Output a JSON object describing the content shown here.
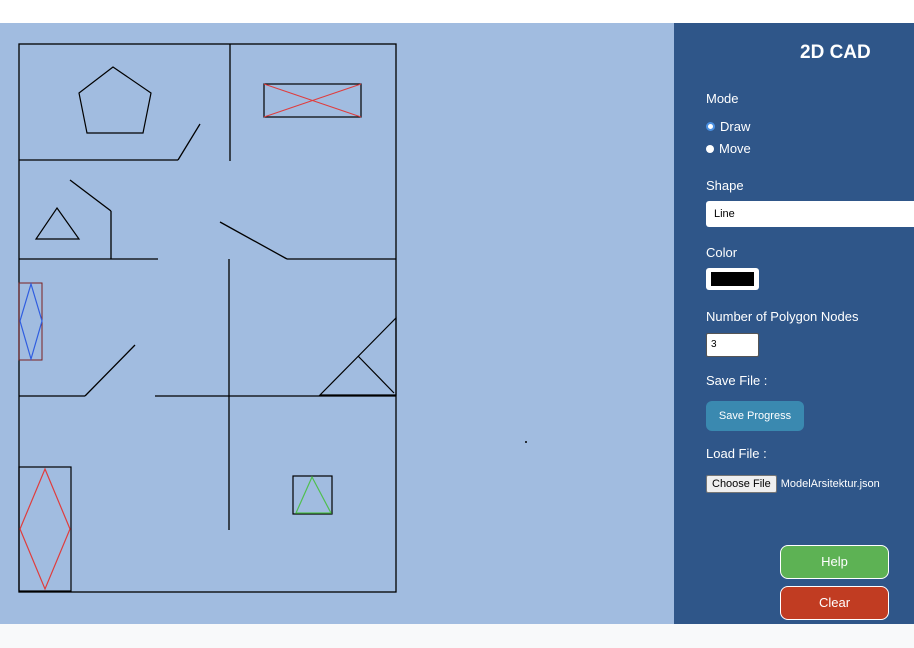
{
  "panel": {
    "title": "2D CAD",
    "mode": {
      "label": "Mode",
      "options": [
        {
          "label": "Draw",
          "checked": true
        },
        {
          "label": "Move",
          "checked": false
        }
      ]
    },
    "shape": {
      "label": "Shape",
      "selected": "Line"
    },
    "color": {
      "label": "Color",
      "value": "#000000"
    },
    "polygon_nodes": {
      "label": "Number of Polygon Nodes",
      "value": "3"
    },
    "save": {
      "label": "Save File :",
      "button": "Save Progress"
    },
    "load": {
      "label": "Load File :",
      "button": "Choose File",
      "filename": "ModelArsitektur.json"
    },
    "help_button": "Help",
    "clear_button": "Clear"
  },
  "colors": {
    "canvas_bg": "#a1bce0",
    "panel_bg": "#2f5689",
    "help": "#5db254",
    "clear": "#c13c22",
    "save": "#3a89b0",
    "shape_red": "#e03c3c",
    "shape_blue": "#2f5de0",
    "shape_green": "#4fbf4f",
    "shape_line": "#000000"
  }
}
